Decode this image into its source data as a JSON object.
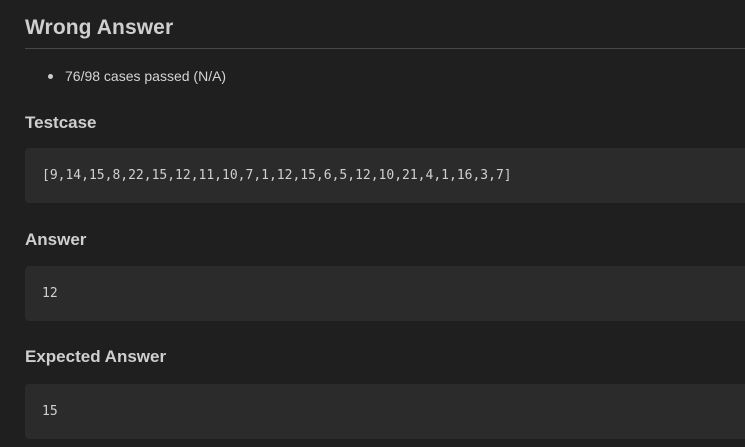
{
  "result": {
    "title": "Wrong Answer",
    "summary": "76/98 cases passed (N/A)"
  },
  "sections": {
    "testcase": {
      "heading": "Testcase",
      "value": "[9,14,15,8,22,15,12,11,10,7,1,12,15,6,5,12,10,21,4,1,16,3,7]"
    },
    "answer": {
      "heading": "Answer",
      "value": "12"
    },
    "expected": {
      "heading": "Expected Answer",
      "value": "15"
    }
  }
}
